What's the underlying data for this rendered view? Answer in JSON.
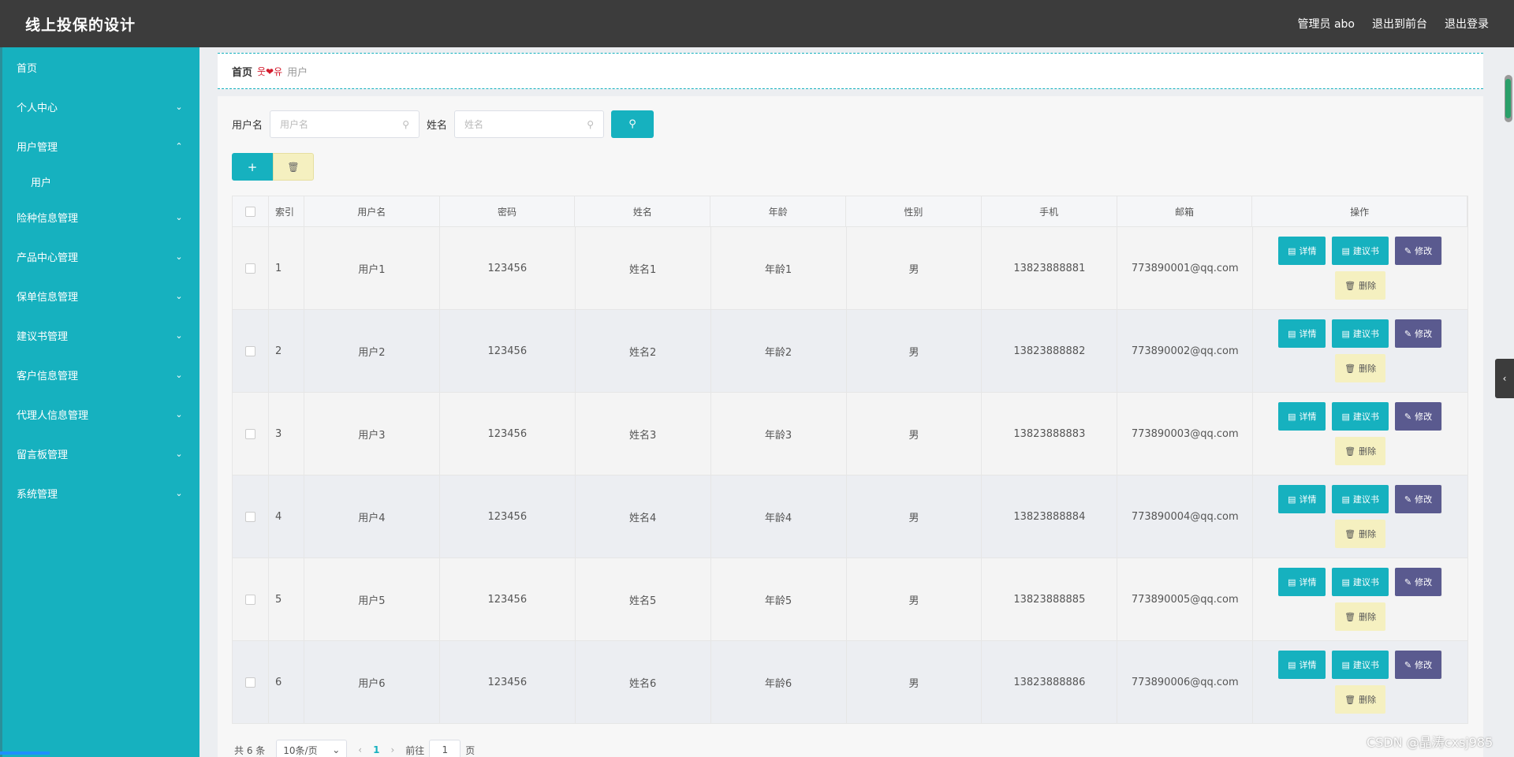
{
  "app": {
    "title": "线上投保的设计"
  },
  "header": {
    "user": "管理员 abo",
    "to_front": "退出到前台",
    "logout": "退出登录"
  },
  "sidebar": {
    "items": [
      {
        "label": "首页",
        "chevron": ""
      },
      {
        "label": "个人中心",
        "chevron": "⌄"
      },
      {
        "label": "用户管理",
        "chevron": "⌃"
      },
      {
        "label": "用户",
        "sub": true
      },
      {
        "label": "险种信息管理",
        "chevron": "⌄"
      },
      {
        "label": "产品中心管理",
        "chevron": "⌄"
      },
      {
        "label": "保单信息管理",
        "chevron": "⌄"
      },
      {
        "label": "建议书管理",
        "chevron": "⌄"
      },
      {
        "label": "客户信息管理",
        "chevron": "⌄"
      },
      {
        "label": "代理人信息管理",
        "chevron": "⌄"
      },
      {
        "label": "留言板管理",
        "chevron": "⌄"
      },
      {
        "label": "系统管理",
        "chevron": "⌄"
      }
    ]
  },
  "breadcrumb": {
    "home": "首页",
    "sep": "웃❤유",
    "current": "用户"
  },
  "search": {
    "username_label": "用户名",
    "username_placeholder": "用户名",
    "name_label": "姓名",
    "name_placeholder": "姓名"
  },
  "table": {
    "headers": [
      "索引",
      "用户名",
      "密码",
      "姓名",
      "年龄",
      "性别",
      "手机",
      "邮箱",
      "操作"
    ],
    "rows": [
      [
        "1",
        "用户1",
        "123456",
        "姓名1",
        "年龄1",
        "男",
        "13823888881",
        "773890001@qq.com"
      ],
      [
        "2",
        "用户2",
        "123456",
        "姓名2",
        "年龄2",
        "男",
        "13823888882",
        "773890002@qq.com"
      ],
      [
        "3",
        "用户3",
        "123456",
        "姓名3",
        "年龄3",
        "男",
        "13823888883",
        "773890003@qq.com"
      ],
      [
        "4",
        "用户4",
        "123456",
        "姓名4",
        "年龄4",
        "男",
        "13823888884",
        "773890004@qq.com"
      ],
      [
        "5",
        "用户5",
        "123456",
        "姓名5",
        "年龄5",
        "男",
        "13823888885",
        "773890005@qq.com"
      ],
      [
        "6",
        "用户6",
        "123456",
        "姓名6",
        "年龄6",
        "男",
        "13823888886",
        "773890006@qq.com"
      ]
    ],
    "ops": {
      "detail": "详情",
      "advice": "建议书",
      "edit": "修改",
      "delete": "删除"
    }
  },
  "pager": {
    "total": "共 6 条",
    "pagesize": "10条/页",
    "page": "1",
    "goto_label": "前往",
    "goto_value": "1",
    "goto_suffix": "页"
  },
  "watermark": "CSDN @晶涛cxsj985",
  "colors": {
    "accent": "#16b1bf",
    "topbar": "#3c3c3c",
    "edit": "#5a5a8f",
    "delete": "#f5f0c0"
  }
}
